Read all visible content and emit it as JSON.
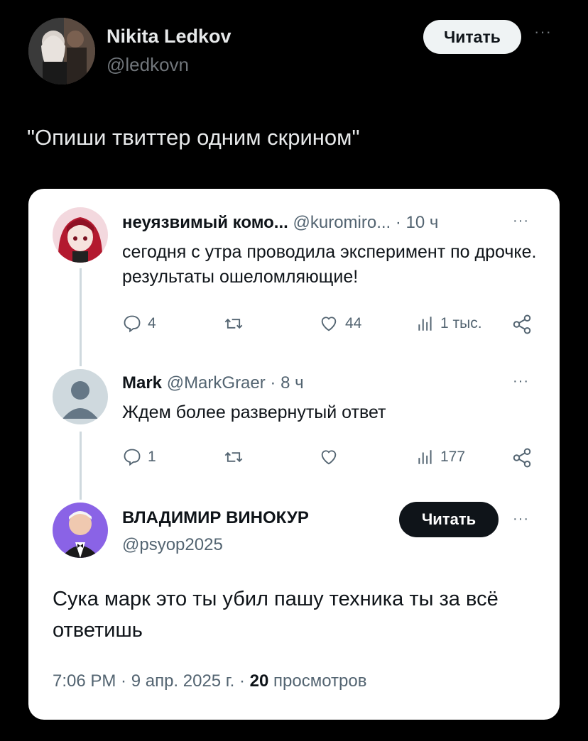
{
  "header": {
    "display_name": "Nikita Ledkov",
    "handle": "@ledkovn",
    "follow_label": "Читать",
    "more_label": "···"
  },
  "post": {
    "text": "\"Опиши твиттер одним скрином\""
  },
  "quoted": {
    "tweets": [
      {
        "name": "неуязвимый комо...",
        "handle": "@kuromiro...",
        "time": "· 10 ч",
        "text": "сегодня с утра проводила эксперимент по дрочке. результаты ошеломляющие!",
        "replies": "4",
        "retweets": "",
        "likes": "44",
        "views": "1 тыс."
      },
      {
        "name": "Mark",
        "handle": "@MarkGraer",
        "time": "· 8 ч",
        "text": "Ждем более развернутый ответ",
        "replies": "1",
        "retweets": "",
        "likes": "",
        "views": "177"
      }
    ],
    "main": {
      "name": "ВЛАДИМИР ВИНОКУР",
      "handle": "@psyop2025",
      "follow_label": "Читать",
      "text": "Сука марк это ты убил пашу техника ты за всё ответишь",
      "time_date": "7:06 PM · 9 апр. 2025 г. · ",
      "views_count": "20",
      "views_label": " просмотров"
    },
    "more_label": "···"
  },
  "colors": {
    "background": "#000000",
    "card": "#ffffff",
    "secondary_text": "#536471",
    "follow_dark": "#0f1419"
  },
  "icons": [
    "reply-icon",
    "retweet-icon",
    "like-icon",
    "views-icon",
    "share-icon",
    "more-icon"
  ]
}
